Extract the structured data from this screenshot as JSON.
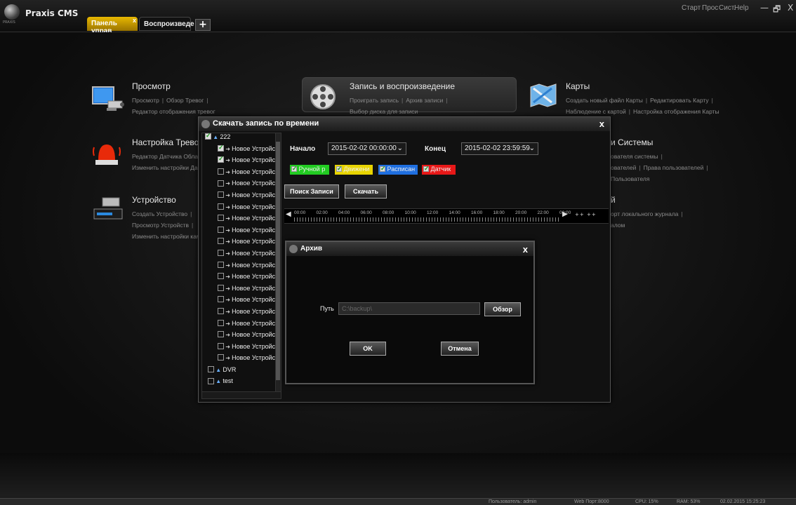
{
  "app": {
    "title": "Praxis CMS",
    "logo_sub": "PRAXIS"
  },
  "tabs": [
    {
      "label": "Панель управ",
      "close": "x"
    },
    {
      "label": "Воспроизведе"
    }
  ],
  "tab_add": "+",
  "sys_menu": [
    "Старт",
    "Прос",
    "Сист.",
    "Help"
  ],
  "window_controls": {
    "minimize": "—",
    "restore": "🗗",
    "close": "X"
  },
  "modules": {
    "view": {
      "title": "Просмотр",
      "links": [
        "Просмотр",
        "Обзор Тревог"
      ],
      "links2": [
        "Редактор отображения тревог"
      ]
    },
    "record": {
      "title": "Запись и воспроизведение",
      "links": [
        "Проиграть запись",
        "Архив записи"
      ],
      "links2": [
        "Выбор диска для записи"
      ]
    },
    "maps": {
      "title": "Карты",
      "links": [
        "Создать новый файл Карты",
        "Редактировать Карту"
      ],
      "links2": [
        "Наблюдение с картой",
        "Настройка отображения Карты"
      ]
    },
    "alarm": {
      "title": "Настройка Тревог",
      "links": [
        "Редактор Датчика Облас"
      ],
      "links2": [
        "Изменить настройки Да"
      ]
    },
    "system": {
      "title": "и Системы",
      "links": [
        "ователя системы"
      ],
      "links2": [
        "ователей",
        "Права пользователей"
      ],
      "links3": [
        "Пользователя"
      ]
    },
    "device": {
      "title": "Устройство",
      "links": [
        "Создать Устройство"
      ],
      "links2": [
        "Просмотр Устройств"
      ],
      "links3": [
        "Изменить настройки кам"
      ]
    },
    "log": {
      "title": "й",
      "links": [
        "орт локального журнала"
      ],
      "links2": [
        "алом"
      ]
    }
  },
  "download_dialog": {
    "title": "Скачать запись по времени",
    "close": "x",
    "tree": {
      "root": "222",
      "item_label": "Новое Устройств",
      "items_checked": [
        true,
        true,
        false,
        false,
        false,
        false,
        false,
        false,
        false,
        false,
        false,
        false,
        false,
        false,
        false,
        false,
        false,
        false,
        false
      ],
      "dvr": "DVR",
      "last": "test"
    },
    "start_label": "Начало",
    "start_value": "2015-02-02 00:00:00",
    "end_label": "Конец",
    "end_value": "2015-02-02 23:59:59",
    "filters": [
      {
        "label": "Ручной р",
        "color": "#22cc22"
      },
      {
        "label": "Движени",
        "color": "#e8d400"
      },
      {
        "label": "Расписан",
        "color": "#1f6fe0"
      },
      {
        "label": "Датчик",
        "color": "#e81818"
      }
    ],
    "search_button": "Поиск Записи",
    "download_button": "Скачать",
    "timeline_labels": [
      "00:00",
      "02:00",
      "04:00",
      "06:00",
      "08:00",
      "10:00",
      "12:00",
      "14:00",
      "16:00",
      "18:00",
      "20:00",
      "22:00",
      "00:00"
    ],
    "timeline_ff": "++ ++"
  },
  "archive_dialog": {
    "title": "Архив",
    "close": "x",
    "path_label": "Путь",
    "path_value": "C:\\backup\\",
    "browse_button": "Обзор",
    "ok_button": "OK",
    "cancel_button": "Отмена"
  },
  "status": {
    "user": "Пользователь: admin",
    "web": "Web Порт:8000",
    "cpu": "CPU: 15%",
    "ram": "RAM: 53%",
    "datetime": "02.02.2015 15:25:23"
  }
}
